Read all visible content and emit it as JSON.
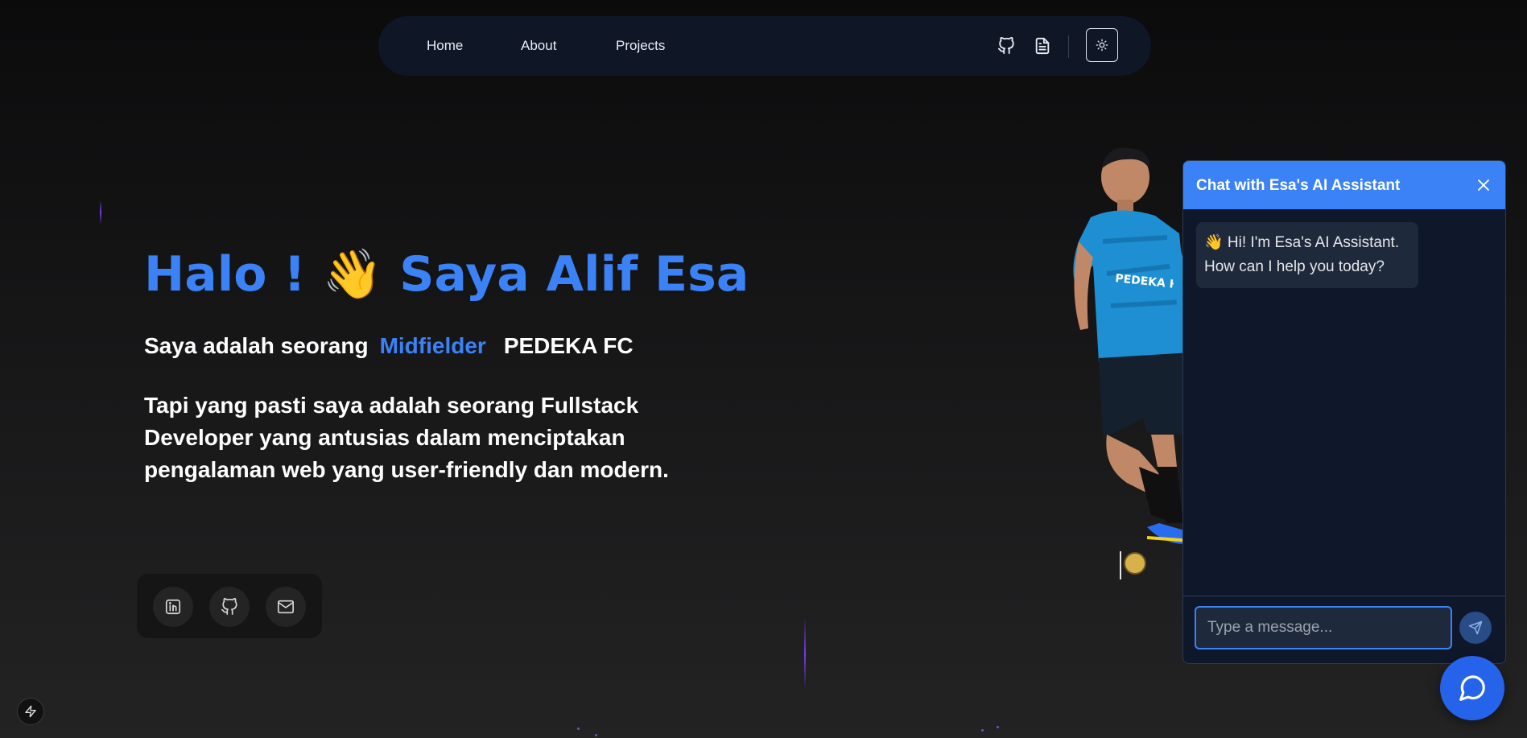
{
  "nav": {
    "links": [
      {
        "label": "Home"
      },
      {
        "label": "About"
      },
      {
        "label": "Projects"
      }
    ],
    "icons": [
      "github-icon",
      "resume-document-icon",
      "sun-icon"
    ]
  },
  "hero": {
    "greeting": "Halo !",
    "wave_emoji": "👋",
    "name": "Saya Alif Esa",
    "sub_prefix": "Saya adalah seorang",
    "role": "Midfielder",
    "team": "PEDEKA FC",
    "description": "Tapi yang pasti saya adalah seorang Fullstack Developer yang antusias dalam menciptakan pengalaman web yang user-friendly dan modern."
  },
  "social": {
    "icons": [
      "linkedin-icon",
      "github-icon",
      "mail-icon"
    ]
  },
  "chat": {
    "title": "Chat with Esa's AI Assistant",
    "greeting_message": "👋 Hi! I'm Esa's AI Assistant. How can I help you today?",
    "input_placeholder": "Type a message...",
    "input_value": ""
  },
  "colors": {
    "accent": "#3b82f6",
    "nav_bg": "#0f1626",
    "chat_bg": "#0f172a",
    "bubble_bg": "#1e293b"
  }
}
